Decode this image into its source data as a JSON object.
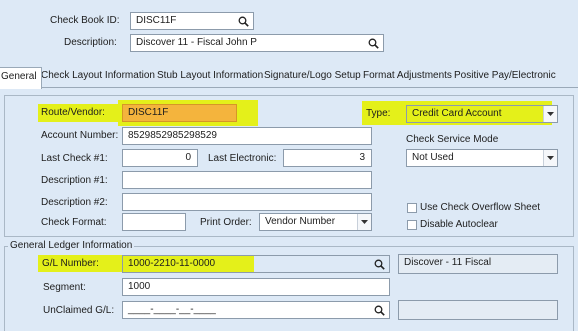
{
  "header": {
    "checkbook_id_label": "Check Book ID:",
    "checkbook_id_value": "DISC11F",
    "description_label": "Description:",
    "description_value": "Discover 11 - Fiscal John P"
  },
  "tabs": [
    {
      "label": "General",
      "active": true
    },
    {
      "label": "Check Layout Information"
    },
    {
      "label": "Stub Layout Information"
    },
    {
      "label": "Signature/Logo Setup"
    },
    {
      "label": "Format Adjustments"
    },
    {
      "label": "Positive Pay/Electronic"
    }
  ],
  "general": {
    "route_vendor_label": "Route/Vendor:",
    "route_vendor_value": "DISC11F",
    "type_label": "Type:",
    "type_value": "Credit Card Account",
    "account_number_label": "Account Number:",
    "account_number_value": "8529852985298529",
    "last_check_label": "Last Check #1:",
    "last_check_value": "0",
    "last_electronic_label": "Last Electronic:",
    "last_electronic_value": "3",
    "check_service_mode_label": "Check Service Mode",
    "check_service_mode_value": "Not Used",
    "description1_label": "Description #1:",
    "description1_value": "",
    "description2_label": "Description #2:",
    "description2_value": "",
    "check_format_label": "Check Format:",
    "check_format_value": "",
    "print_order_label": "Print Order:",
    "print_order_value": "Vendor Number",
    "use_overflow_label": "Use Check Overflow Sheet",
    "use_overflow_checked": false,
    "disable_autoclear_label": "Disable Autoclear",
    "disable_autoclear_checked": false
  },
  "gl": {
    "section_title": "General Ledger Information",
    "gl_number_label": "G/L Number:",
    "gl_number_value": "1000-2210-11-0000",
    "gl_description": "Discover - 11 Fiscal",
    "segment_label": "Segment:",
    "segment_value": "1000",
    "unclaimed_label": "UnClaimed G/L:",
    "unclaimed_value": "____-____-__-____",
    "unclaimed_description": ""
  },
  "colors": {
    "highlight_yellow": "#e4f01a",
    "highlight_orange": "#f4b43d",
    "background": "#dde9f6"
  },
  "icons": {
    "lookup": "magnifier-icon",
    "dropdown": "chevron-down-icon"
  }
}
